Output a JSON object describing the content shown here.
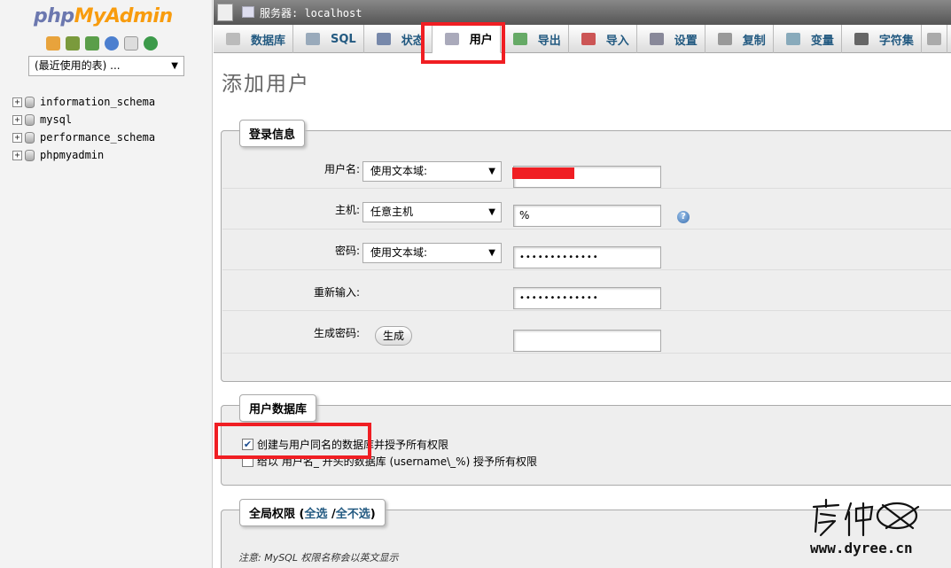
{
  "nav": {
    "logo_php": "php",
    "logo_myadmin": "MyAdmin",
    "icons": [
      "home-icon",
      "exit-icon",
      "query-window-icon",
      "docs-icon",
      "sql-docs-icon",
      "reload-icon"
    ],
    "recent_select": "(最近使用的表) ...",
    "databases": [
      "information_schema",
      "mysql",
      "performance_schema",
      "phpmyadmin"
    ]
  },
  "serverbar": {
    "label": "服务器: localhost"
  },
  "tabs": [
    {
      "label": "数据库",
      "icon": "database-icon"
    },
    {
      "label": "SQL",
      "icon": "sql-icon"
    },
    {
      "label": "状态",
      "icon": "status-icon"
    },
    {
      "label": "用户",
      "icon": "users-icon",
      "active": true
    },
    {
      "label": "导出",
      "icon": "export-icon"
    },
    {
      "label": "导入",
      "icon": "import-icon"
    },
    {
      "label": "设置",
      "icon": "settings-icon"
    },
    {
      "label": "复制",
      "icon": "replication-icon"
    },
    {
      "label": "变量",
      "icon": "variables-icon"
    },
    {
      "label": "字符集",
      "icon": "charset-icon"
    }
  ],
  "page": {
    "title": "添加用户"
  },
  "login": {
    "legend": "登录信息",
    "username_label": "用户名:",
    "username_type": "使用文本域:",
    "username_value": "",
    "host_label": "主机:",
    "host_type": "任意主机",
    "host_value": "%",
    "password_label": "密码:",
    "password_type": "使用文本域:",
    "password_value": "•••••••••••••",
    "retype_label": "重新输入:",
    "retype_value": "•••••••••••••",
    "generate_label": "生成密码:",
    "generate_button": "生成"
  },
  "userdb": {
    "legend": "用户数据库",
    "option1": "创建与用户同名的数据库并授予所有权限",
    "option1_checked": true,
    "option2": "给以 用户名_ 开头的数据库 (username\\_%) 授予所有权限",
    "option2_checked": false
  },
  "global": {
    "legend_prefix": "全局权限 (",
    "select_all": "全选",
    "separator": " /",
    "deselect_all": "全不选",
    "legend_suffix": ")",
    "note": "注意: MySQL 权限名称会以英文显示"
  },
  "watermark": {
    "text": "www.dyree.cn"
  },
  "colors": {
    "accent": "#235a81",
    "annotation": "#f01e23",
    "logo_php": "#6c78af",
    "logo_myadmin": "#f89c0e"
  }
}
